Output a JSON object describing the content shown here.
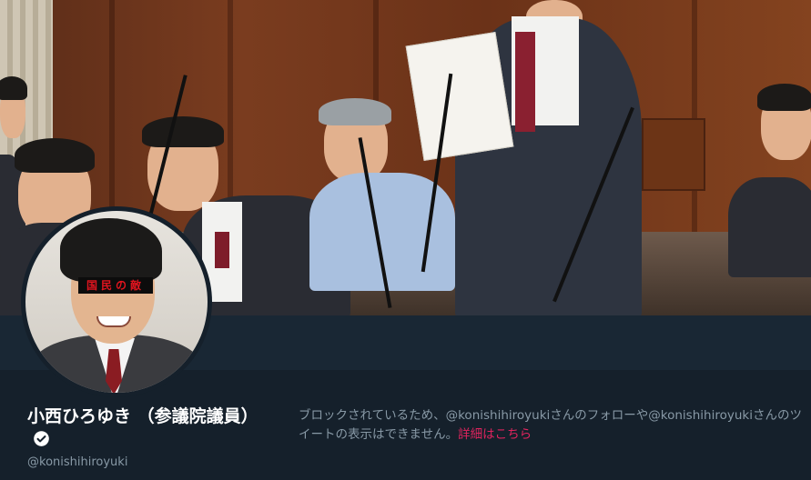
{
  "profile": {
    "display_name": "小西ひろゆき （参議院議員）",
    "handle": "@konishihiroyuki",
    "verified": true,
    "verified_icon": "verified-badge-icon",
    "avatar_overlay_text": "国民の敵"
  },
  "notice": {
    "blocked_message": "ブロックされているため、@konishihiroyukiさんのフォローや@konishihiroyukiさんのツイートの表示はできません。",
    "details_link": "詳細はこちら"
  },
  "colors": {
    "background": "#15202b",
    "header_strip": "#192734",
    "secondary_text": "#8899a6",
    "link": "#e0245e",
    "avatar_overlay": "#e0141e"
  }
}
